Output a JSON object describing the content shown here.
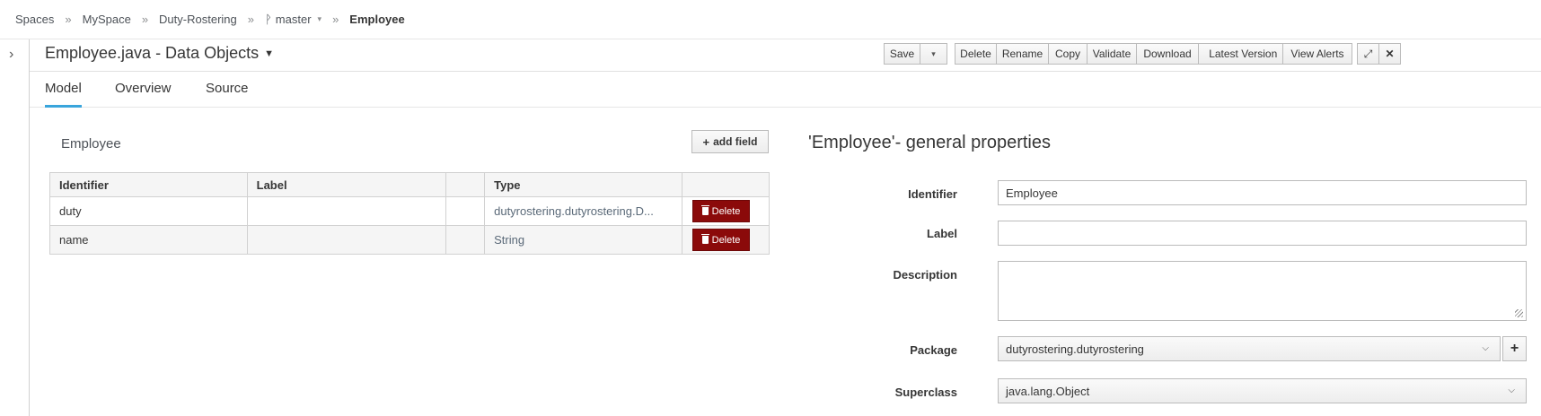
{
  "breadcrumb": {
    "items": [
      "Spaces",
      "MySpace",
      "Duty-Rostering"
    ],
    "branch": "master",
    "current": "Employee",
    "separator": "»"
  },
  "header": {
    "title": "Employee.java - Data Objects",
    "toolbar": {
      "save": "Save",
      "delete": "Delete",
      "rename": "Rename",
      "copy": "Copy",
      "validate": "Validate",
      "download": "Download",
      "latest_version": "Latest Version",
      "view_alerts": "View Alerts",
      "maximize_glyph": "⤢",
      "close_glyph": "✕"
    }
  },
  "tabs": [
    "Model",
    "Overview",
    "Source"
  ],
  "model": {
    "object_name": "Employee",
    "add_field": "add field",
    "columns": [
      "Identifier",
      "Label",
      "",
      "Type",
      ""
    ],
    "rows": [
      {
        "identifier": "duty",
        "label": "",
        "type": "dutyrostering.dutyrostering.D...",
        "action": "Delete"
      },
      {
        "identifier": "name",
        "label": "",
        "type": "String",
        "action": "Delete"
      }
    ]
  },
  "properties": {
    "title": "'Employee'- general properties",
    "identifier_label": "Identifier",
    "identifier_value": "Employee",
    "label_label": "Label",
    "label_value": "",
    "description_label": "Description",
    "package_label": "Package",
    "package_value": "dutyrostering.dutyrostering",
    "superclass_label": "Superclass",
    "superclass_value": "java.lang.Object"
  },
  "icons": {
    "expand": "›",
    "dropdown": "⌄",
    "plus": "+",
    "trash": "trash-icon",
    "branch": "ᚹ"
  },
  "colors": {
    "delete_button": "#8b0a0a",
    "active_tab": "#39a5dc"
  }
}
